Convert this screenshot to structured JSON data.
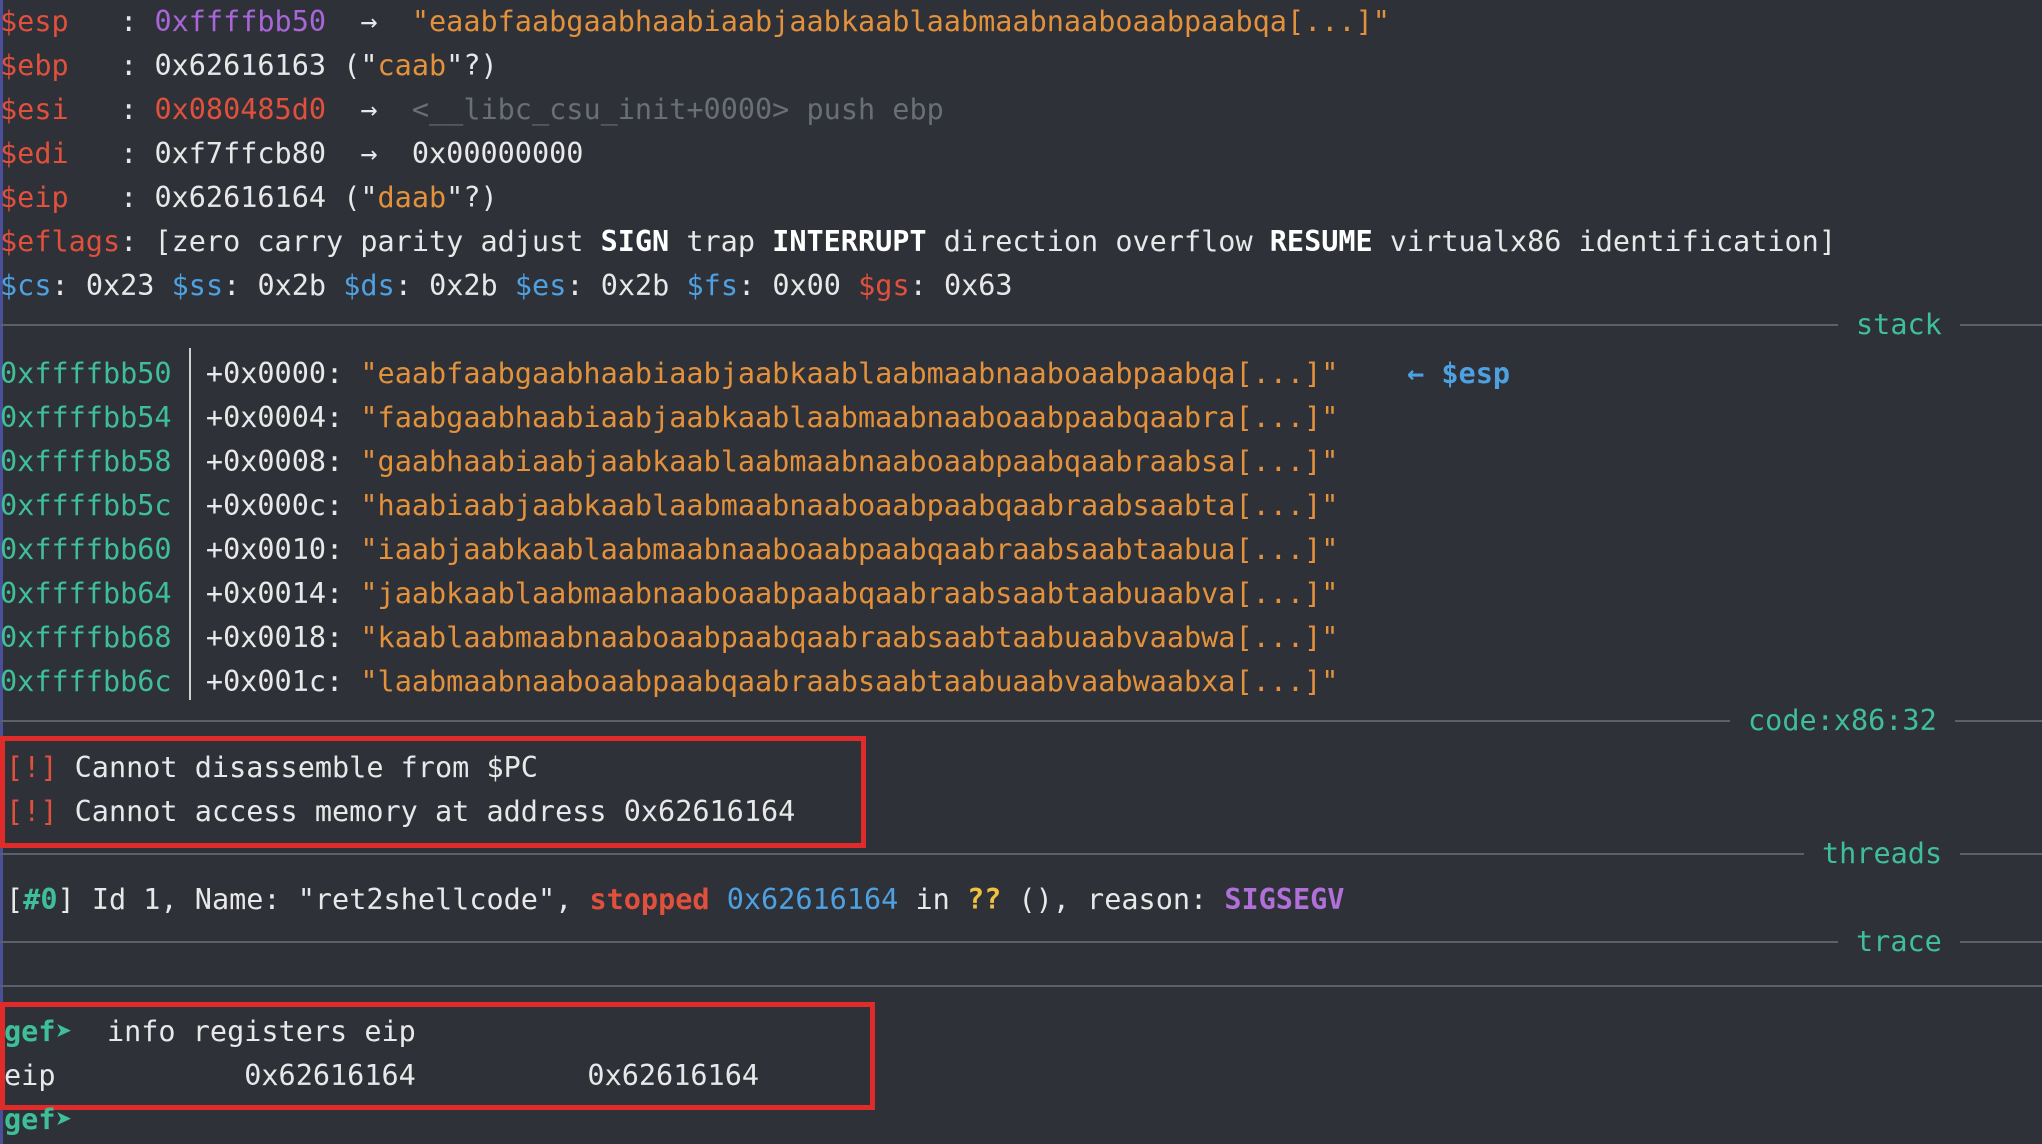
{
  "registers": {
    "esp": {
      "name": "$esp",
      "pad": "   : ",
      "value": "0xffffbb50",
      "arrow": "→",
      "deref": "\"eaabfaabgaabhaabiaabjaabkaablaabmaabnaaboaabpaabqa[...]\""
    },
    "ebp": {
      "name": "$ebp",
      "pad": "   : ",
      "value": "0x62616163",
      "extra": " (\"",
      "str": "caab",
      "extra2": "\"?)"
    },
    "esi": {
      "name": "$esi",
      "pad": "   : ",
      "value": "0x080485d0",
      "arrow": "→",
      "deref": "<__libc_csu_init+0000> push ebp"
    },
    "edi": {
      "name": "$edi",
      "pad": "   : ",
      "value": "0xf7ffcb80",
      "arrow": "→",
      "deref": "0x00000000"
    },
    "eip": {
      "name": "$eip",
      "pad": "   : ",
      "value": "0x62616164",
      "extra": " (\"",
      "str": "daab",
      "extra2": "\"?)"
    },
    "eflags": {
      "name": "$eflags",
      "pad": ": ",
      "open": "[zero carry parity adjust ",
      "sign": "SIGN",
      "trap": " trap ",
      "interrupt": "INTERRUPT",
      "mid": " direction overflow ",
      "resume": "RESUME",
      "close": " virtualx86 identification]"
    },
    "segments": [
      {
        "name": "$cs",
        "value": "0x23"
      },
      {
        "name": "$ss",
        "value": "0x2b"
      },
      {
        "name": "$ds",
        "value": "0x2b"
      },
      {
        "name": "$es",
        "value": "0x2b"
      },
      {
        "name": "$fs",
        "value": "0x00"
      },
      {
        "name": "$gs",
        "value": "0x63"
      }
    ]
  },
  "sections": {
    "stack": "stack",
    "code": "code:x86:32",
    "threads": "threads",
    "trace": "trace"
  },
  "stack": {
    "pointer_label": "← $esp",
    "rows": [
      {
        "addr": "0xffffbb50",
        "offset": "+0x0000:",
        "value": "\"eaabfaabgaabhaabiaabjaabkaablaabmaabnaaboaabpaabqa[...]\""
      },
      {
        "addr": "0xffffbb54",
        "offset": "+0x0004:",
        "value": "\"faabgaabhaabiaabjaabkaablaabmaabnaaboaabpaabqaabra[...]\""
      },
      {
        "addr": "0xffffbb58",
        "offset": "+0x0008:",
        "value": "\"gaabhaabiaabjaabkaablaabmaabnaaboaabpaabqaabraabsa[...]\""
      },
      {
        "addr": "0xffffbb5c",
        "offset": "+0x000c:",
        "value": "\"haabiaabjaabkaablaabmaabnaaboaabpaabqaabraabsaabta[...]\""
      },
      {
        "addr": "0xffffbb60",
        "offset": "+0x0010:",
        "value": "\"iaabjaabkaablaabmaabnaaboaabpaabqaabraabsaabtaabua[...]\""
      },
      {
        "addr": "0xffffbb64",
        "offset": "+0x0014:",
        "value": "\"jaabkaablaabmaabnaaboaabpaabqaabraabsaabtaabuaabva[...]\""
      },
      {
        "addr": "0xffffbb68",
        "offset": "+0x0018:",
        "value": "\"kaablaabmaabnaaboaabpaabqaabraabsaabtaabuaabvaabwa[...]\""
      },
      {
        "addr": "0xffffbb6c",
        "offset": "+0x001c:",
        "value": "\"laabmaabnaaboaabpaabqaabraabsaabtaabuaabvaabwaabxa[...]\""
      }
    ]
  },
  "code": {
    "errors": [
      {
        "tag": "[!]",
        "text": " Cannot disassemble from $PC"
      },
      {
        "tag": "[!]",
        "text": " Cannot access memory at address 0x62616164"
      }
    ]
  },
  "threads": {
    "open": "[",
    "num": "#0",
    "close": "]",
    "info": " Id 1, Name: \"ret2shellcode\", ",
    "state": "stopped",
    "addr": " 0x62616164",
    "in": " in ",
    "func": "??",
    "rest": " (), reason: ",
    "reason": "SIGSEGV"
  },
  "console": {
    "prompt": "gef➤",
    "command": "  info registers eip",
    "reg": "eip",
    "hex": "0x62616164",
    "natural": "0x62616164"
  }
}
